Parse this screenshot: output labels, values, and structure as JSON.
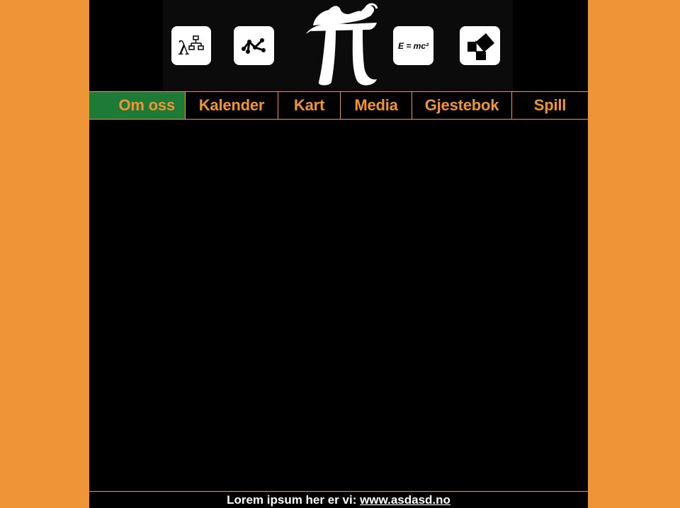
{
  "colors": {
    "background": "#f09537",
    "page": "#000000",
    "accent": "#f09537",
    "active_tab": "#1d7a37",
    "footer_text": "#ffffff"
  },
  "banner": {
    "tiles": [
      {
        "icon": "lambda-flowchart-icon"
      },
      {
        "icon": "graph-network-icon"
      },
      {
        "icon": "pi-woman-logo"
      },
      {
        "icon": "e-equals-mc2-icon",
        "text": "E = mc²"
      },
      {
        "icon": "pythagoras-squares-icon"
      }
    ]
  },
  "nav": {
    "items": [
      {
        "label": "Om oss",
        "active": true
      },
      {
        "label": "Kalender",
        "active": false
      },
      {
        "label": "Kart",
        "active": false
      },
      {
        "label": "Media",
        "active": false
      },
      {
        "label": "Gjestebok",
        "active": false
      },
      {
        "label": "Spill",
        "active": false
      }
    ]
  },
  "footer": {
    "text": "Lorem ipsum her er vi: ",
    "link": "www.asdasd.no"
  }
}
